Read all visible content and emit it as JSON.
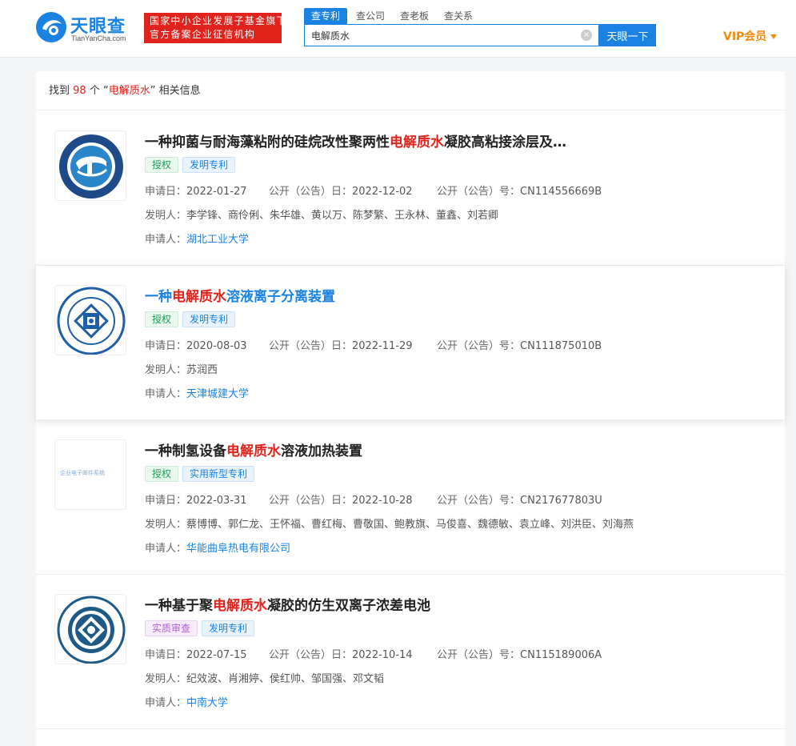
{
  "header": {
    "logo_cn": "天眼查",
    "logo_en": "TianYanCha.com",
    "badge_line1": "国家中小企业发展子基金旗下",
    "badge_line2": "官方备案企业征信机构",
    "tabs": [
      {
        "label": "查专利"
      },
      {
        "label": "查公司"
      },
      {
        "label": "查老板"
      },
      {
        "label": "查关系"
      }
    ],
    "search_value": "电解质水",
    "search_button": "天眼一下",
    "vip_label": "VIP会员"
  },
  "summary": {
    "prefix": "找到",
    "count": "98",
    "mid": "个 “",
    "keyword": "电解质水",
    "suffix": "” 相关信息"
  },
  "labels": {
    "apply_date": "申请日：",
    "pub_date": "公开（公告）日：",
    "pub_no": "公开（公告）号：",
    "inventor": "发明人：",
    "applicant": "申请人："
  },
  "results": [
    {
      "title_pre": "一种抑菌与耐海藻粘附的硅烷改性聚两性",
      "title_hl": "电解质水",
      "title_post": "凝胶高粘接涂层及…",
      "tags": [
        "授权",
        "发明专利"
      ],
      "apply_date": "2022-01-27",
      "pub_date": "2022-12-02",
      "pub_no": "CN114556669B",
      "inventors": "李学锋、商伶俐、朱华雄、黄以万、陈梦繁、王永林、董鑫、刘若卿",
      "applicant": "湖北工业大学"
    },
    {
      "title_pre": "一种",
      "title_hl": "电解质水",
      "title_post": "溶液离子分离装置",
      "tags": [
        "授权",
        "发明专利"
      ],
      "apply_date": "2020-08-03",
      "pub_date": "2022-11-29",
      "pub_no": "CN111875010B",
      "inventors": "苏润西",
      "applicant": "天津城建大学"
    },
    {
      "title_pre": "一种制氢设备",
      "title_hl": "电解质水",
      "title_post": "溶液加热装置",
      "tags": [
        "授权",
        "实用新型专利"
      ],
      "apply_date": "2022-03-31",
      "pub_date": "2022-10-28",
      "pub_no": "CN217677803U",
      "inventors": "蔡博博、郭仁龙、王怀福、曹红梅、曹敬国、鲍教旗、马俊喜、魏德敏、袁立峰、刘洪臣、刘海燕",
      "applicant": "华能曲阜热电有限公司",
      "logo_text": "企业电子邮件系统"
    },
    {
      "title_pre": "一种基于聚",
      "title_hl": "电解质水",
      "title_post": "凝胶的仿生双离子浓差电池",
      "tags": [
        "实质审查",
        "发明专利"
      ],
      "apply_date": "2022-07-15",
      "pub_date": "2022-10-14",
      "pub_no": "CN115189006A",
      "inventors": "纪效波、肖湘婷、侯红帅、邹国强、邓文韬",
      "applicant": "中南大学"
    }
  ],
  "colors": {
    "brand_blue": "#1a82e0",
    "highlight_red": "#e0231c",
    "vip_orange": "#ef8a0a"
  }
}
